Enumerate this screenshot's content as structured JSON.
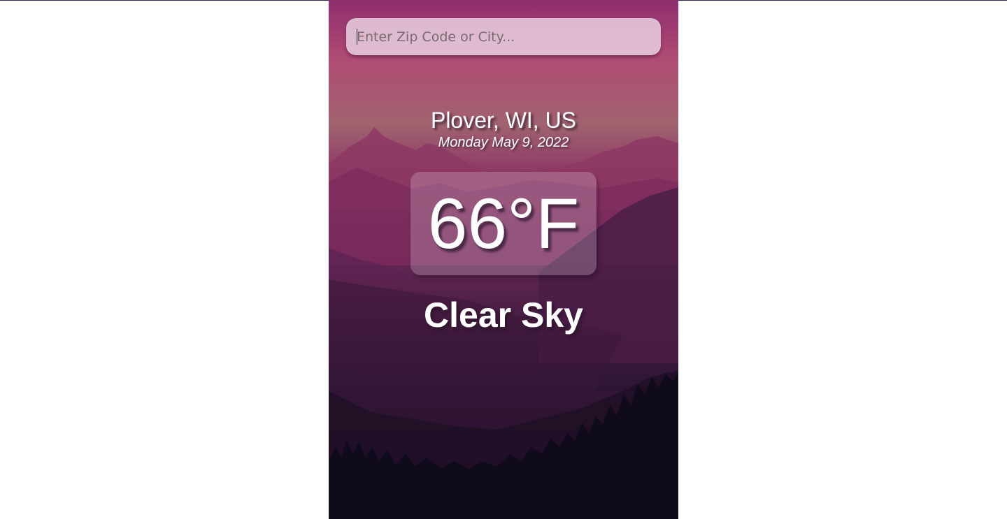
{
  "search": {
    "placeholder": "Enter Zip Code or City...",
    "value": ""
  },
  "weather": {
    "location": "Plover, WI, US",
    "date": "Monday May 9, 2022",
    "temperature": "66°F",
    "condition": "Clear Sky"
  },
  "colors": {
    "topline": "#2c2a5e",
    "text": "#ffffff",
    "sky_top": "#8f2e6e",
    "sky_glow": "#a0636f",
    "ground": "#0a0716"
  }
}
